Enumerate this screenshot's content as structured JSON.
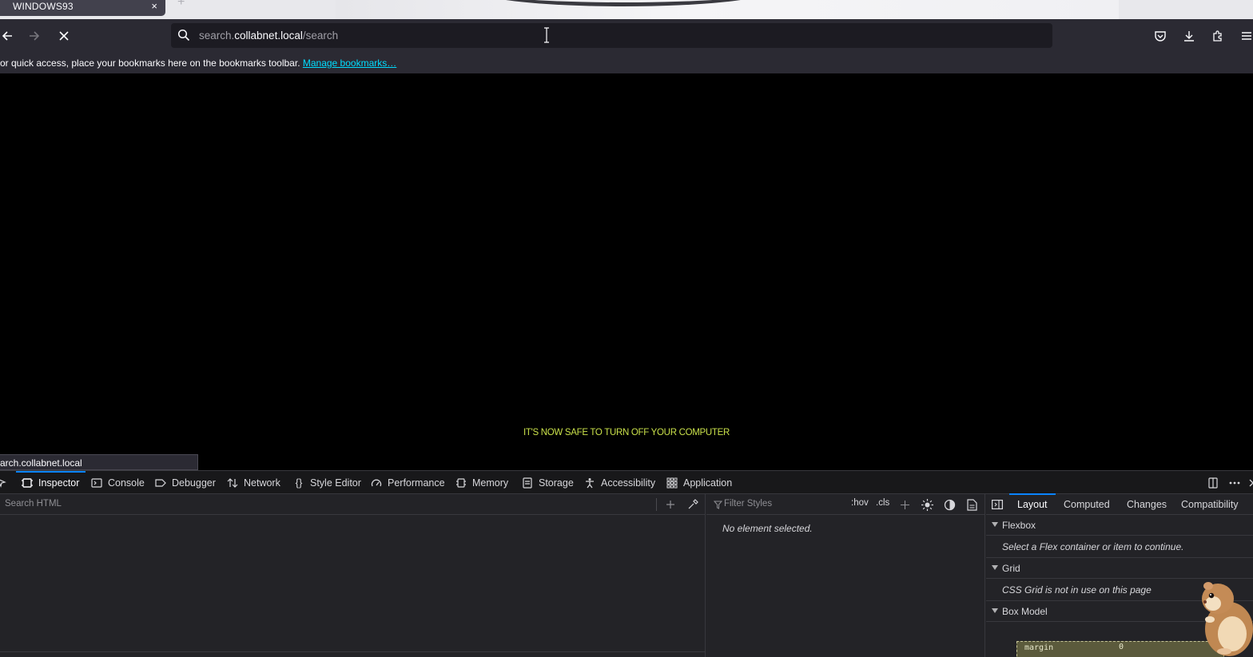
{
  "tab": {
    "title": "WINDOWS93",
    "close": "×",
    "new_tab": "+"
  },
  "urlbar": {
    "prefix": "search.",
    "host": "collabnet.local",
    "path": "/search"
  },
  "bookmarks": {
    "message": "or quick access, place your bookmarks here on the bookmarks toolbar. ",
    "link": "Manage bookmarks…"
  },
  "content": {
    "message": "IT'S NOW SAFE TO TURN OFF YOUR COMPUTER",
    "status_url": "arch.collabnet.local"
  },
  "devtools": {
    "tabs": [
      {
        "label": "Inspector",
        "icon": "inspector-icon",
        "selected": true
      },
      {
        "label": "Console",
        "icon": "console-icon"
      },
      {
        "label": "Debugger",
        "icon": "debugger-icon"
      },
      {
        "label": "Network",
        "icon": "network-icon"
      },
      {
        "label": "Style Editor",
        "icon": "style-editor-icon"
      },
      {
        "label": "Performance",
        "icon": "performance-icon"
      },
      {
        "label": "Memory",
        "icon": "memory-icon"
      },
      {
        "label": "Storage",
        "icon": "storage-icon"
      },
      {
        "label": "Accessibility",
        "icon": "accessibility-icon"
      },
      {
        "label": "Application",
        "icon": "application-icon"
      }
    ],
    "markup": {
      "search_placeholder": "Search HTML"
    },
    "rules": {
      "filter_placeholder": "Filter Styles",
      "hov": ":hov",
      "cls": ".cls",
      "no_element": "No element selected."
    },
    "sidebar": {
      "tabs": [
        "Layout",
        "Computed",
        "Changes",
        "Compatibility"
      ],
      "selected_tab": "Layout",
      "flexbox": {
        "title": "Flexbox",
        "body": "Select a Flex container or item to continue."
      },
      "grid": {
        "title": "Grid",
        "body": "CSS Grid is not in use on this page"
      },
      "box_model": {
        "title": "Box Model",
        "margin_label": "margin",
        "margin_value": "0"
      }
    }
  },
  "colors": {
    "accent": "#0a84ff",
    "message": "#c9e04a",
    "link": "#00ddff",
    "toolbar": "#2b2a33",
    "devtools_bg": "#232327"
  }
}
